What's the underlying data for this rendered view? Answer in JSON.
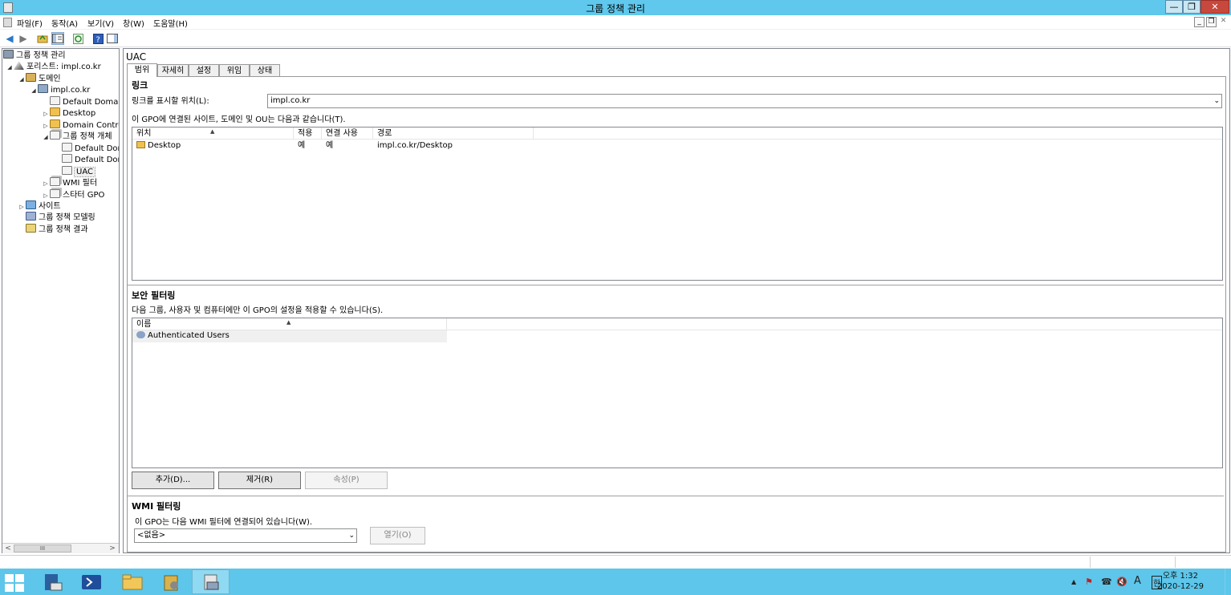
{
  "window": {
    "title": "그룹 정책 관리",
    "min": "—",
    "restore": "❐",
    "close": "✕"
  },
  "menu": {
    "items": [
      "파일(F)",
      "동작(A)",
      "보기(V)",
      "창(W)",
      "도움말(H)"
    ],
    "mdi_min": "_",
    "mdi_restore": "❐",
    "mdi_close": "✕"
  },
  "tree": {
    "items": [
      {
        "label": "그룹 정책 관리",
        "expander": "",
        "icon": "gpm-icon"
      },
      {
        "label": "포리스트: impl.co.kr",
        "expander": "◢",
        "icon": "forest-icon"
      },
      {
        "label": "도메인",
        "expander": "◢",
        "icon": "domains-icon"
      },
      {
        "label": "impl.co.kr",
        "expander": "◢",
        "icon": "domain-icon"
      },
      {
        "label": "Default Domain Policy",
        "expander": "",
        "icon": "gpo-link-icon"
      },
      {
        "label": "Desktop",
        "expander": "▷",
        "icon": "ou-folder-icon"
      },
      {
        "label": "Domain Controllers",
        "expander": "▷",
        "icon": "ou-folder-icon"
      },
      {
        "label": "그룹 정책 개체",
        "expander": "◢",
        "icon": "gpo-container-icon"
      },
      {
        "label": "Default Domain Controllers Policy",
        "expander": "",
        "icon": "gpo-icon"
      },
      {
        "label": "Default Domain Policy",
        "expander": "",
        "icon": "gpo-icon"
      },
      {
        "label": "UAC",
        "expander": "",
        "icon": "gpo-icon"
      },
      {
        "label": "WMI 필터",
        "expander": "▷",
        "icon": "wmi-folder-icon"
      },
      {
        "label": "스타터 GPO",
        "expander": "▷",
        "icon": "starter-gpo-folder-icon"
      },
      {
        "label": "사이트",
        "expander": "▷",
        "icon": "sites-icon"
      },
      {
        "label": "그룹 정책 모델링",
        "expander": "",
        "icon": "modeling-icon"
      },
      {
        "label": "그룹 정책 결과",
        "expander": "",
        "icon": "results-icon"
      }
    ]
  },
  "gpo": {
    "name": "UAC",
    "tabs": [
      "범위",
      "자세히",
      "설정",
      "위임",
      "상태"
    ],
    "active_tab": "범위"
  },
  "links": {
    "title": "링크",
    "location_label": "링크를 표시할 위치(L):",
    "location_value": "impl.co.kr",
    "desc": "이 GPO에 연결된 사이트, 도메인 및 OU는 다음과 같습니다(T).",
    "columns": [
      "위치",
      "적용",
      "연결 사용",
      "경로"
    ],
    "rows": [
      {
        "location": "Desktop",
        "enforced": "예",
        "link_enabled": "예",
        "path": "impl.co.kr/Desktop"
      }
    ]
  },
  "security": {
    "title": "보안 필터링",
    "desc": "다음 그룹, 사용자 및 컴퓨터에만 이 GPO의 설정을 적용할 수 있습니다(S).",
    "columns": [
      "이름"
    ],
    "rows": [
      "Authenticated Users"
    ],
    "buttons": {
      "add": "추가(D)...",
      "remove": "제거(R)",
      "properties": "속성(P)"
    }
  },
  "wmi": {
    "title": "WMI 필터링",
    "desc": "이 GPO는 다음 WMI 필터에 연결되어 있습니다(W).",
    "value": "<없음>",
    "open": "열기(O)"
  },
  "scroll": {
    "thumb": "III"
  },
  "taskbar": {
    "apps": [
      "server-manager-icon",
      "powershell-icon",
      "explorer-icon",
      "admin-tools-icon",
      "gpm-console-icon"
    ],
    "tray": [
      "▲",
      "⚑",
      "☎",
      "🔇",
      "A",
      "한"
    ],
    "time": "오후 1:32",
    "date": "2020-12-29"
  }
}
